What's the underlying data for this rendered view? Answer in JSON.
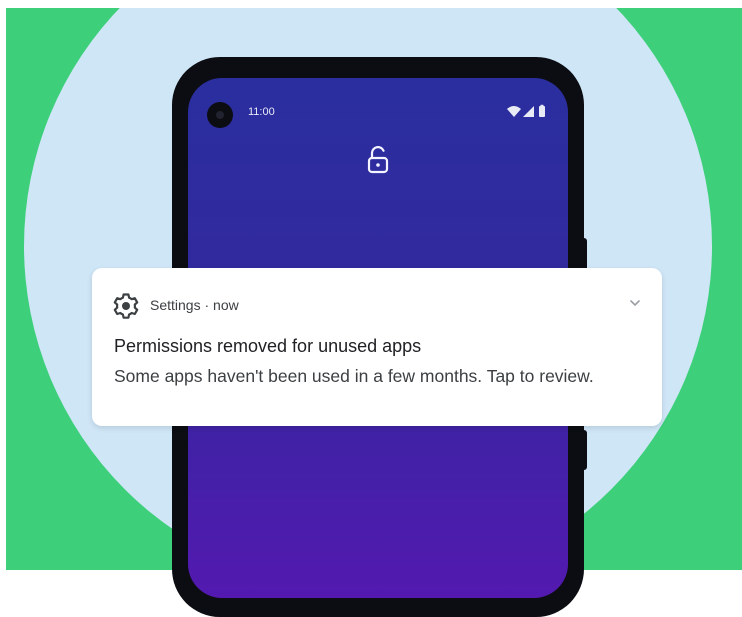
{
  "status_bar": {
    "time": "11:00"
  },
  "notification": {
    "app_name": "Settings",
    "separator": " · ",
    "timestamp": "now",
    "title": "Permissions removed for unused apps",
    "body": "Some apps haven't been used in a few months. Tap to review."
  },
  "icons": {
    "app": "gear-icon",
    "expand": "chevron-down-icon",
    "lock": "unlocked-padlock-icon",
    "wifi": "wifi-icon",
    "signal": "cellular-signal-icon",
    "battery": "battery-icon",
    "camera": "front-camera"
  },
  "colors": {
    "background": "#3ecf7a",
    "circle": "#cfe6f7",
    "phone_frame": "#0c0d12",
    "screen_top": "#2a2e9e",
    "screen_bottom": "#5319b0",
    "notification_bg": "#ffffff",
    "text_primary": "#202124",
    "text_secondary": "#3c4043"
  }
}
